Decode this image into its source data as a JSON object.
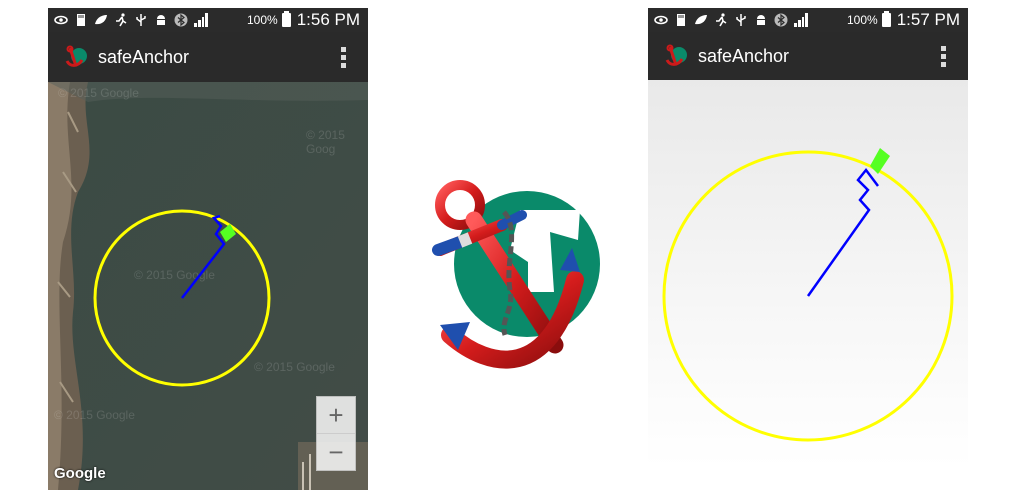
{
  "left_screen": {
    "status": {
      "battery_pct": "100%",
      "time": "1:56 PM"
    },
    "action_bar": {
      "title": "safeAnchor"
    },
    "map": {
      "watermarks": [
        "© 2015 Google",
        "© 2015 Goog",
        "© 2015 Google",
        "© 2015 Google",
        "© 2015 Google"
      ],
      "zoom_in_label": "+",
      "zoom_out_label": "−",
      "attribution": "Google"
    }
  },
  "right_screen": {
    "status": {
      "battery_pct": "100%",
      "time": "1:57 PM"
    },
    "action_bar": {
      "title": "safeAnchor"
    }
  },
  "colors": {
    "radius_circle": "#ffff00",
    "track_line": "#0000ff",
    "boat_marker": "#55ff22",
    "action_bar": "#2a2a2a",
    "status_bar": "#2b2b2b",
    "anchor_red": "#cc1a1a",
    "logo_teal": "#0a8a6a"
  },
  "icons": {
    "status": [
      "eye-icon",
      "sd-card-icon",
      "leaf-icon",
      "running-icon",
      "usb-icon",
      "android-icon",
      "bluetooth-icon",
      "signal-icon",
      "battery-icon"
    ],
    "app": "safeanchor-app-icon",
    "menu": "overflow-menu-icon",
    "center": "safeanchor-logo-icon"
  }
}
